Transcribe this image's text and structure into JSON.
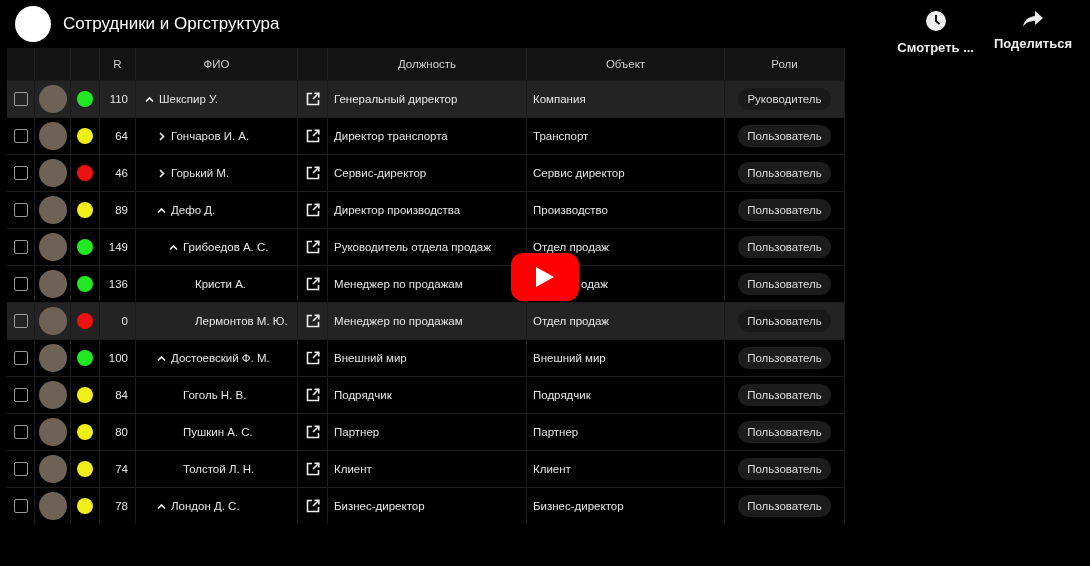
{
  "player": {
    "title": "Сотрудники и Оргструктура",
    "actions": [
      {
        "kind": "watch-later",
        "label": "Смотреть ..."
      },
      {
        "kind": "share",
        "label": "Поделиться"
      }
    ]
  },
  "table": {
    "headers": {
      "r": "R",
      "name": "ФИО",
      "position": "Должность",
      "object": "Объект",
      "roles": "Роли"
    },
    "rows": [
      {
        "checked": false,
        "color": "#22e822",
        "r": "110",
        "name": "Шекспир У.",
        "expanded": true,
        "selected": true,
        "position": "Генеральный директор",
        "object": "Компания",
        "role": "Руководитель",
        "children": [
          {
            "checked": false,
            "color": "#f2ee1a",
            "r": "64",
            "name": "Гончаров И. А.",
            "expanded": false,
            "selected": false,
            "position": "Директор транспорта",
            "object": "Транспорт",
            "role": "Пользователь"
          },
          {
            "checked": false,
            "color": "#ee1111",
            "r": "46",
            "name": "Горький М.",
            "expanded": false,
            "selected": false,
            "position": "Сервис-директор",
            "object": "Сервис директор",
            "role": "Пользователь"
          },
          {
            "checked": false,
            "color": "#f2ee1a",
            "r": "89",
            "name": "Дефо Д.",
            "expanded": true,
            "selected": false,
            "position": "Директор производства",
            "object": "Производство",
            "role": "Пользователь",
            "children": [
              {
                "checked": false,
                "color": "#22e822",
                "r": "149",
                "name": "Грибоедов А. С.",
                "expanded": true,
                "selected": false,
                "position": "Руководитель отдела продаж",
                "object": "Отдел продаж",
                "role": "Пользователь",
                "children": [
                  {
                    "checked": false,
                    "color": "#22e822",
                    "r": "136",
                    "name": "Кристи А.",
                    "selected": false,
                    "position": "Менеджер по продажам",
                    "object": "одаж",
                    "under_play_button": true,
                    "role": "Пользователь"
                  },
                  {
                    "checked": false,
                    "color": "#ee1111",
                    "r": "0",
                    "name": "Лермонтов М. Ю.",
                    "selected": true,
                    "position": "Менеджер по продажам",
                    "object": "Отдел продаж",
                    "role": "Пользователь"
                  }
                ]
              }
            ]
          },
          {
            "checked": false,
            "color": "#22e822",
            "r": "100",
            "name": "Достоевский Ф. М.",
            "expanded": true,
            "selected": false,
            "position": "Внешний мир",
            "object": "Внешний мир",
            "role": "Пользователь",
            "children": [
              {
                "checked": false,
                "color": "#f2ee1a",
                "r": "84",
                "name": "Гоголь Н. В.",
                "selected": false,
                "position": "Подрядчик",
                "object": "Подрядчик",
                "role": "Пользователь"
              },
              {
                "checked": false,
                "color": "#f2ee1a",
                "r": "80",
                "name": "Пушкин А. С.",
                "selected": false,
                "position": "Партнер",
                "object": "Партнер",
                "role": "Пользователь"
              },
              {
                "checked": false,
                "color": "#f2ee1a",
                "r": "74",
                "name": "Толстой Л. Н.",
                "selected": false,
                "position": "Клиент",
                "object": "Клиент",
                "role": "Пользователь"
              }
            ]
          },
          {
            "checked": false,
            "color": "#f2ee1a",
            "r": "78",
            "name": "Лондон Д. С.",
            "expanded": true,
            "selected": false,
            "position": "Бизнес-директор",
            "object": "Бизнес-директор",
            "role": "Пользователь"
          }
        ]
      }
    ]
  }
}
